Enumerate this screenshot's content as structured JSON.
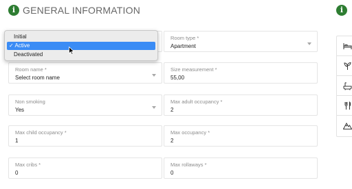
{
  "header": {
    "title": "GENERAL INFORMATION",
    "info_icon": "i"
  },
  "status_dropdown": {
    "options": [
      "Initial",
      "Active",
      "Deactivated"
    ],
    "selected": "Active",
    "check": "✓"
  },
  "fields": {
    "room_type": {
      "label": "Room type *",
      "value": "Apartment"
    },
    "room_name": {
      "label": "Room name *",
      "value": "Select room name"
    },
    "size_measurement": {
      "label": "Size measurement *",
      "value": "55,00"
    },
    "non_smoking": {
      "label": "Non smoking",
      "value": "Yes"
    },
    "max_adult_occupancy": {
      "label": "Max adult occupancy *",
      "value": "2"
    },
    "max_child_occupancy": {
      "label": "Max child occupancy *",
      "value": "1"
    },
    "max_occupancy": {
      "label": "Max occupancy *",
      "value": "2"
    },
    "max_cribs": {
      "label": "Max cribs *",
      "value": "0"
    },
    "max_rollaways": {
      "label": "Max rollaways *",
      "value": "0"
    }
  },
  "side_panel": {
    "icons": [
      "bed-icon",
      "plant-icon",
      "bathtub-icon",
      "dining-icon",
      "mountain-icon"
    ]
  },
  "colors": {
    "accent_green": "#2e7d32",
    "selection_blue": "#3b8cf5"
  }
}
